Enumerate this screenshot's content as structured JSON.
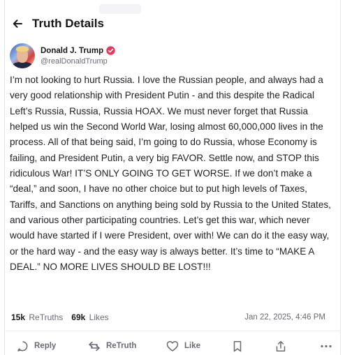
{
  "header": {
    "title": "Truth Details",
    "back_icon": "arrow-left-icon"
  },
  "author": {
    "name": "Donald J. Trump",
    "handle": "@realDonaldTrump",
    "verified_icon": "verified-badge-icon",
    "verified_color": "#e8385d"
  },
  "post": {
    "text": "I’m not looking to hurt Russia. I love the Russian people, and always had a very good relationship with President Putin - and this despite the Radical Left’s Russia, Russia, Russia HOAX. We must never forget that Russia helped us win the Second World War, losing almost 60,000,000 lives in the process. All of that being said, I’m going to do Russia, whose Economy is failing, and President Putin, a very big FAVOR. Settle now, and STOP this ridiculous War! IT’S ONLY GOING TO GET WORSE. If we don’t make a “deal,” and soon, I have no other choice but to put high levels of Taxes, Tariffs, and Sanctions on anything being sold by Russia to the United States, and various other participating countries. Let’s get this war, which never would have started if I were President, over with! We can do it the easy way, or the hard way - and the easy way is always better. It’s time to “MAKE A DEAL.” NO MORE LIVES SHOULD BE LOST!!!"
  },
  "stats": {
    "retruths_count": "15k",
    "retruths_label": "ReTruths",
    "likes_count": "69k",
    "likes_label": "Likes",
    "timestamp": "Jan 22, 2025, 4:46 PM"
  },
  "actions": {
    "reply_label": "Reply",
    "retruth_label": "ReTruth",
    "like_label": "Like",
    "icons": [
      "reply-icon",
      "retruth-icon",
      "like-icon",
      "bookmark-icon",
      "share-icon",
      "more-icon"
    ]
  }
}
